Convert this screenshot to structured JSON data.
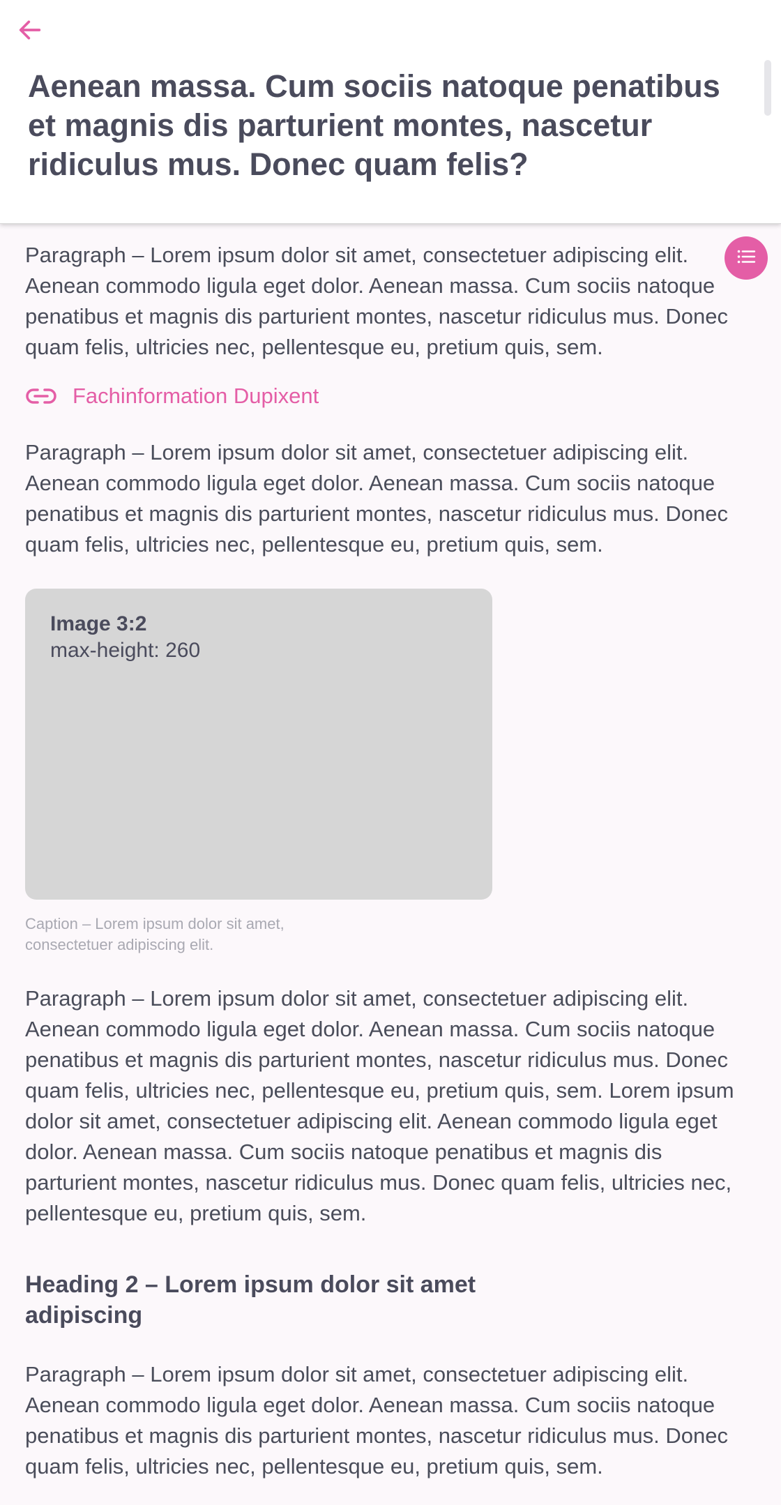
{
  "header": {
    "title": "Aenean massa. Cum sociis natoque penatibus et magnis dis parturient montes, nascetur ridiculus mus. Donec quam felis?"
  },
  "icons": {
    "back": "arrow-left-icon",
    "toc": "list-icon",
    "link": "link-icon"
  },
  "colors": {
    "accent": "#e45ea6",
    "text": "#4a4d5a",
    "image_placeholder": "#d6d6d6"
  },
  "article": {
    "para1": "Paragraph – Lorem ipsum dolor sit amet, consectetuer adipiscing elit. Aenean commodo ligula eget dolor. Aenean massa. Cum sociis natoque penatibus et magnis dis parturient montes, nascetur ridiculus mus. Donec quam felis, ultricies nec, pellentesque eu, pretium quis, sem.",
    "link_label": "Fachinformation Dupixent",
    "para2": "Paragraph – Lorem ipsum dolor sit amet, consectetuer adipiscing elit. Aenean commodo ligula eget dolor. Aenean massa. Cum sociis natoque penatibus et magnis dis parturient montes, nascetur ridiculus mus. Donec quam felis, ultricies nec, pellentesque eu, pretium quis, sem.",
    "image_title": "Image 3:2",
    "image_subtitle": "max-height: 260",
    "caption": "Caption – Lorem ipsum dolor sit amet, consectetuer adipiscing elit.",
    "para3": "Paragraph – Lorem ipsum dolor sit amet, consectetuer adipiscing elit. Aenean commodo ligula eget dolor. Aenean massa. Cum sociis natoque penatibus et magnis dis parturient montes, nascetur ridiculus mus. Donec quam felis, ultricies nec, pellentesque eu, pretium quis, sem. Lorem ipsum dolor sit amet, consectetuer adipiscing elit. Aenean commodo ligula eget dolor. Aenean massa. Cum sociis natoque penatibus et magnis dis parturient montes, nascetur ridiculus mus. Donec quam felis, ultricies nec, pellentesque eu, pretium quis, sem.",
    "heading2": "Heading 2 – Lorem ipsum dolor sit amet adipiscing",
    "para4": "Paragraph – Lorem ipsum dolor sit amet, consectetuer adipiscing elit. Aenean commodo ligula eget dolor. Aenean massa. Cum sociis natoque penatibus et magnis dis parturient montes, nascetur ridiculus mus. Donec quam felis, ultricies nec, pellentesque eu, pretium quis, sem."
  }
}
